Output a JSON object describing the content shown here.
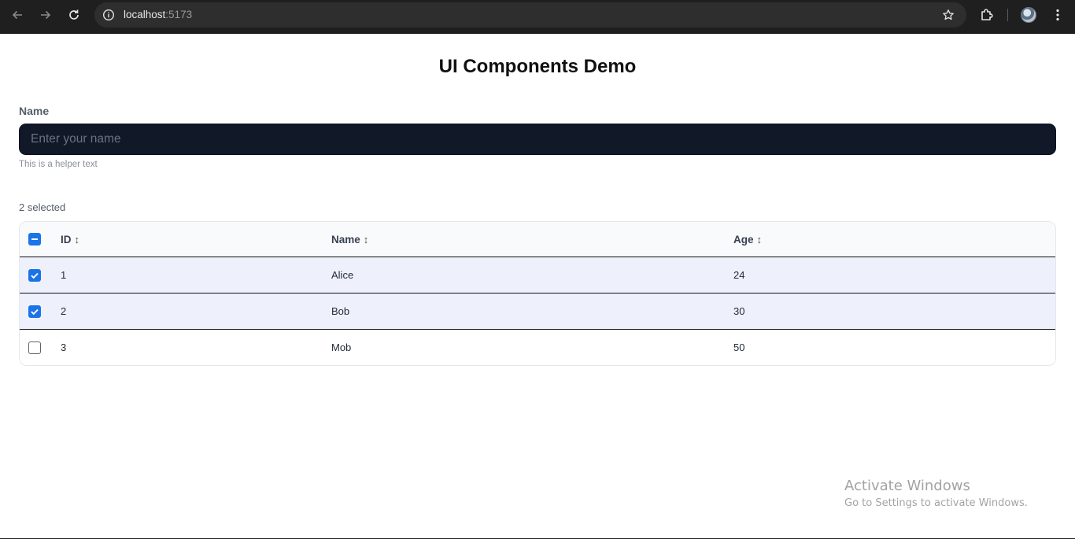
{
  "browser": {
    "url_host": "localhost",
    "url_port": ":5173",
    "icons": {
      "back": "arrow-left-icon",
      "forward": "arrow-right-icon",
      "reload": "reload-icon",
      "site_info": "info-circle-icon",
      "bookmark": "star-icon",
      "extensions": "puzzle-icon",
      "menu": "kebab-menu-icon"
    }
  },
  "page": {
    "title": "UI Components Demo"
  },
  "name_field": {
    "label": "Name",
    "value": "",
    "placeholder": "Enter your name",
    "helper": "This is a helper text"
  },
  "table": {
    "selected_text": "2 selected",
    "columns": [
      {
        "label": "ID",
        "sort_icon": "↕"
      },
      {
        "label": "Name",
        "sort_icon": "↕"
      },
      {
        "label": "Age",
        "sort_icon": "↕"
      }
    ],
    "header_checkbox_state": "indeterminate",
    "rows": [
      {
        "id": "1",
        "name": "Alice",
        "age": "24",
        "selected": true
      },
      {
        "id": "2",
        "name": "Bob",
        "age": "30",
        "selected": true
      },
      {
        "id": "3",
        "name": "Mob",
        "age": "50",
        "selected": false
      }
    ]
  },
  "watermark": {
    "title": "Activate Windows",
    "subtitle": "Go to Settings to activate Windows."
  },
  "colors": {
    "input_bg": "#111827",
    "selected_row_bg": "#eef1fb",
    "checkbox_accent": "#1a73e8",
    "chrome_bg": "#1f1f1f"
  }
}
